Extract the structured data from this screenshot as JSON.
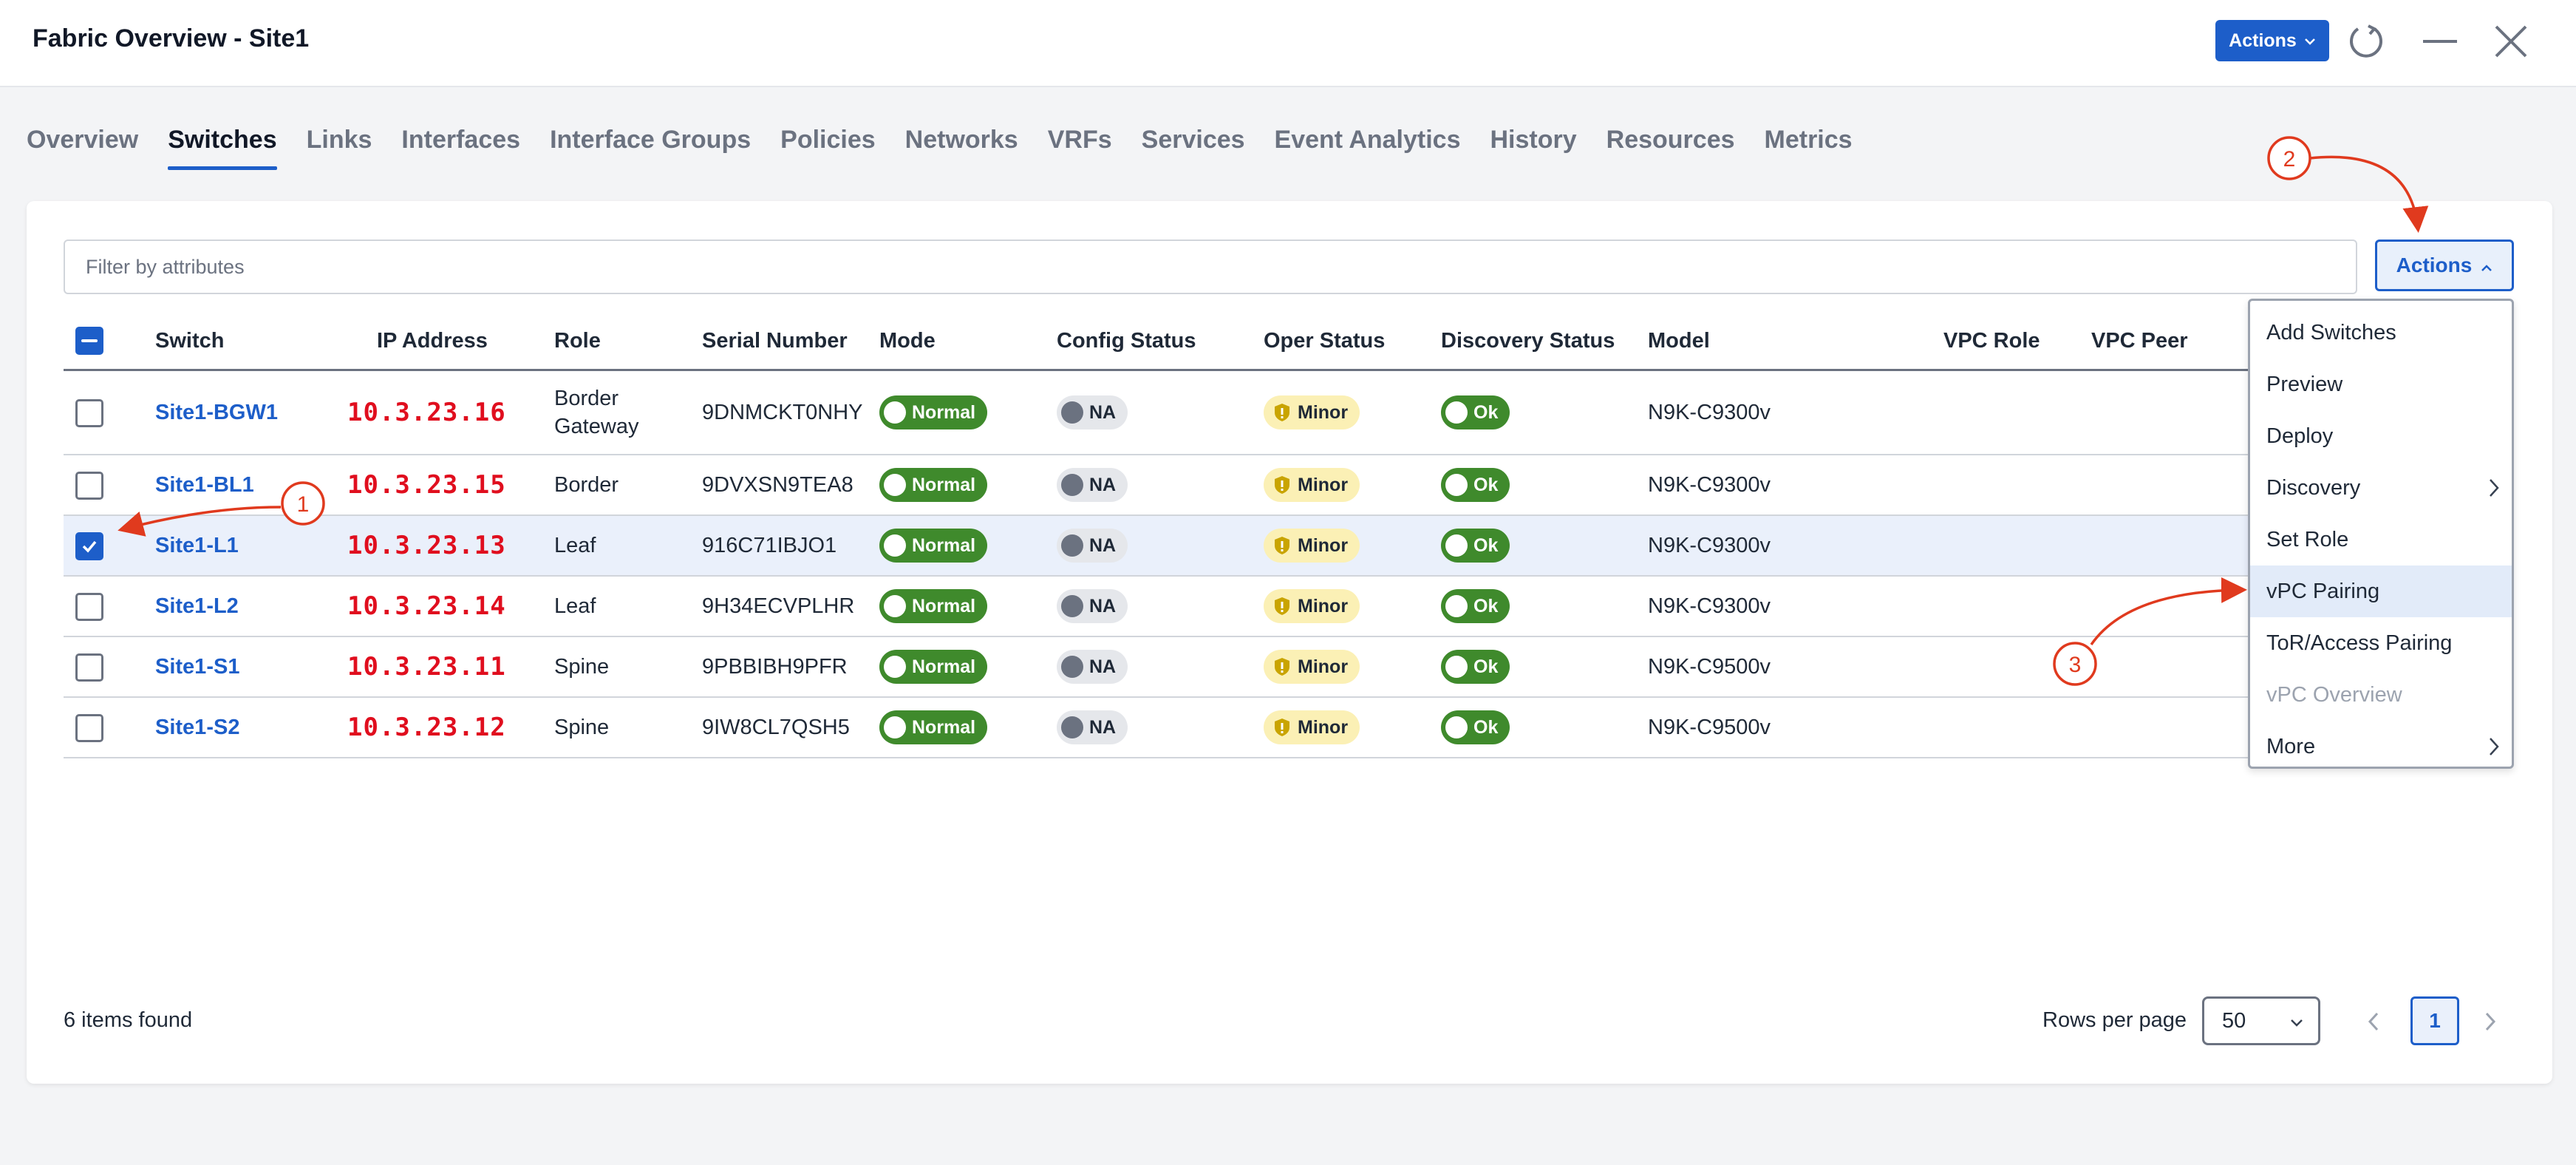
{
  "window": {
    "title": "Fabric Overview - Site1",
    "actions_label": "Actions"
  },
  "tabs": [
    {
      "label": "Overview"
    },
    {
      "label": "Switches",
      "active": true
    },
    {
      "label": "Links"
    },
    {
      "label": "Interfaces"
    },
    {
      "label": "Interface Groups"
    },
    {
      "label": "Policies"
    },
    {
      "label": "Networks"
    },
    {
      "label": "VRFs"
    },
    {
      "label": "Services"
    },
    {
      "label": "Event Analytics"
    },
    {
      "label": "History"
    },
    {
      "label": "Resources"
    },
    {
      "label": "Metrics"
    }
  ],
  "filter": {
    "placeholder": "Filter by attributes"
  },
  "actions": {
    "label": "Actions"
  },
  "table": {
    "columns": [
      "Switch",
      "IP Address",
      "Role",
      "Serial Number",
      "Mode",
      "Config Status",
      "Oper Status",
      "Discovery Status",
      "Model",
      "VPC Role",
      "VPC Peer"
    ],
    "rows": [
      {
        "switch": "Site1-BGW1",
        "ip": "10.3.23.16",
        "role": "Border Gateway",
        "serial": "9DNMCKT0NHY",
        "mode": "Normal",
        "config": "NA",
        "oper": "Minor",
        "discovery": "Ok",
        "model": "N9K-C9300v",
        "selected": false
      },
      {
        "switch": "Site1-BL1",
        "ip": "10.3.23.15",
        "role": "Border",
        "serial": "9DVXSN9TEA8",
        "mode": "Normal",
        "config": "NA",
        "oper": "Minor",
        "discovery": "Ok",
        "model": "N9K-C9300v",
        "selected": false
      },
      {
        "switch": "Site1-L1",
        "ip": "10.3.23.13",
        "role": "Leaf",
        "serial": "916C71IBJO1",
        "mode": "Normal",
        "config": "NA",
        "oper": "Minor",
        "discovery": "Ok",
        "model": "N9K-C9300v",
        "selected": true
      },
      {
        "switch": "Site1-L2",
        "ip": "10.3.23.14",
        "role": "Leaf",
        "serial": "9H34ECVPLHR",
        "mode": "Normal",
        "config": "NA",
        "oper": "Minor",
        "discovery": "Ok",
        "model": "N9K-C9300v",
        "selected": false
      },
      {
        "switch": "Site1-S1",
        "ip": "10.3.23.11",
        "role": "Spine",
        "serial": "9PBBIBH9PFR",
        "mode": "Normal",
        "config": "NA",
        "oper": "Minor",
        "discovery": "Ok",
        "model": "N9K-C9500v",
        "selected": false
      },
      {
        "switch": "Site1-S2",
        "ip": "10.3.23.12",
        "role": "Spine",
        "serial": "9IW8CL7QSH5",
        "mode": "Normal",
        "config": "NA",
        "oper": "Minor",
        "discovery": "Ok",
        "model": "N9K-C9500v",
        "selected": false
      }
    ]
  },
  "menu": {
    "items": [
      {
        "label": "Add Switches"
      },
      {
        "label": "Preview"
      },
      {
        "label": "Deploy"
      },
      {
        "label": "Discovery",
        "submenu": true
      },
      {
        "label": "Set Role"
      },
      {
        "label": "vPC Pairing",
        "highlighted": true
      },
      {
        "label": "ToR/Access Pairing"
      },
      {
        "label": "vPC Overview",
        "disabled": true
      },
      {
        "label": "More",
        "submenu": true
      }
    ]
  },
  "footer": {
    "items_found": "6 items found",
    "rows_per_page_label": "Rows per page",
    "rows_per_page_value": "50",
    "current_page": "1"
  },
  "annotations": {
    "step1": "1",
    "step2": "2",
    "step3": "3"
  },
  "colors": {
    "accent": "#1d5ec9",
    "ip_red": "#e00e1e",
    "status_green": "#3f8a2c",
    "minor_yellow": "#fbf0b5",
    "annotation_red": "#e03a1e"
  }
}
